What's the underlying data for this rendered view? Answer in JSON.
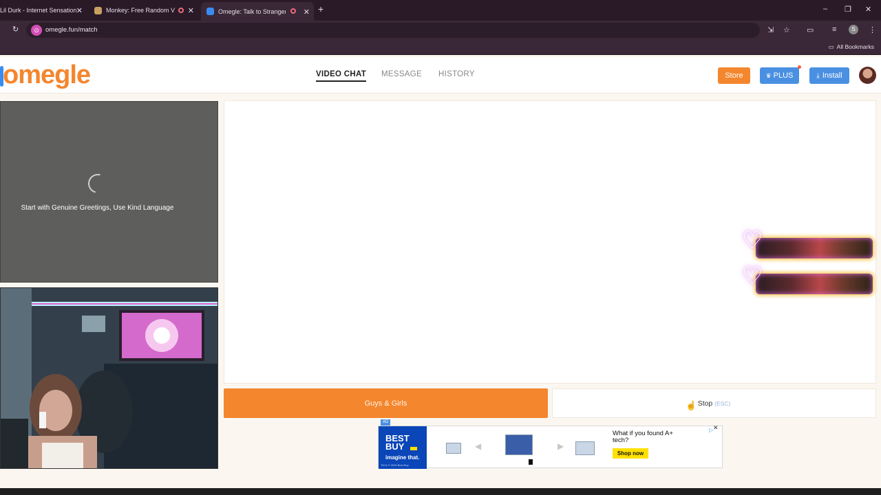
{
  "browser": {
    "tabs": [
      {
        "title": "Lil Durk - Internet Sensation",
        "active": false
      },
      {
        "title": "Monkey: Free Random Vide",
        "active": false,
        "recording": true
      },
      {
        "title": "Omegle: Talk to Strangers o",
        "active": true,
        "recording": true
      }
    ],
    "new_tab": "+",
    "url": "omegle.fun/match",
    "bookmarks_label": "All Bookmarks",
    "profile_initial": "S"
  },
  "header": {
    "logo": "omegle",
    "nav": [
      {
        "label": "VIDEO CHAT",
        "active": true
      },
      {
        "label": "MESSAGE",
        "active": false
      },
      {
        "label": "HISTORY",
        "active": false
      }
    ],
    "store_label": "Store",
    "plus_label": "PLUS",
    "install_label": "Install",
    "colors": {
      "orange": "#f4862e",
      "blue": "#4a90e2"
    }
  },
  "self_panel": {
    "greeting": "Start with Genuine Greetings, Use Kind Language"
  },
  "controls": {
    "match_label": "Guys & Girls",
    "stop_label": "Stop",
    "stop_hint": "(ESC)"
  },
  "ad": {
    "tag": "AD",
    "brand": "BEST BUY",
    "tagline": "imagine that.",
    "fineprint": "TM & © 2025 Best Buy",
    "headline": "What if you found A+ tech?",
    "cta": "Shop now"
  }
}
